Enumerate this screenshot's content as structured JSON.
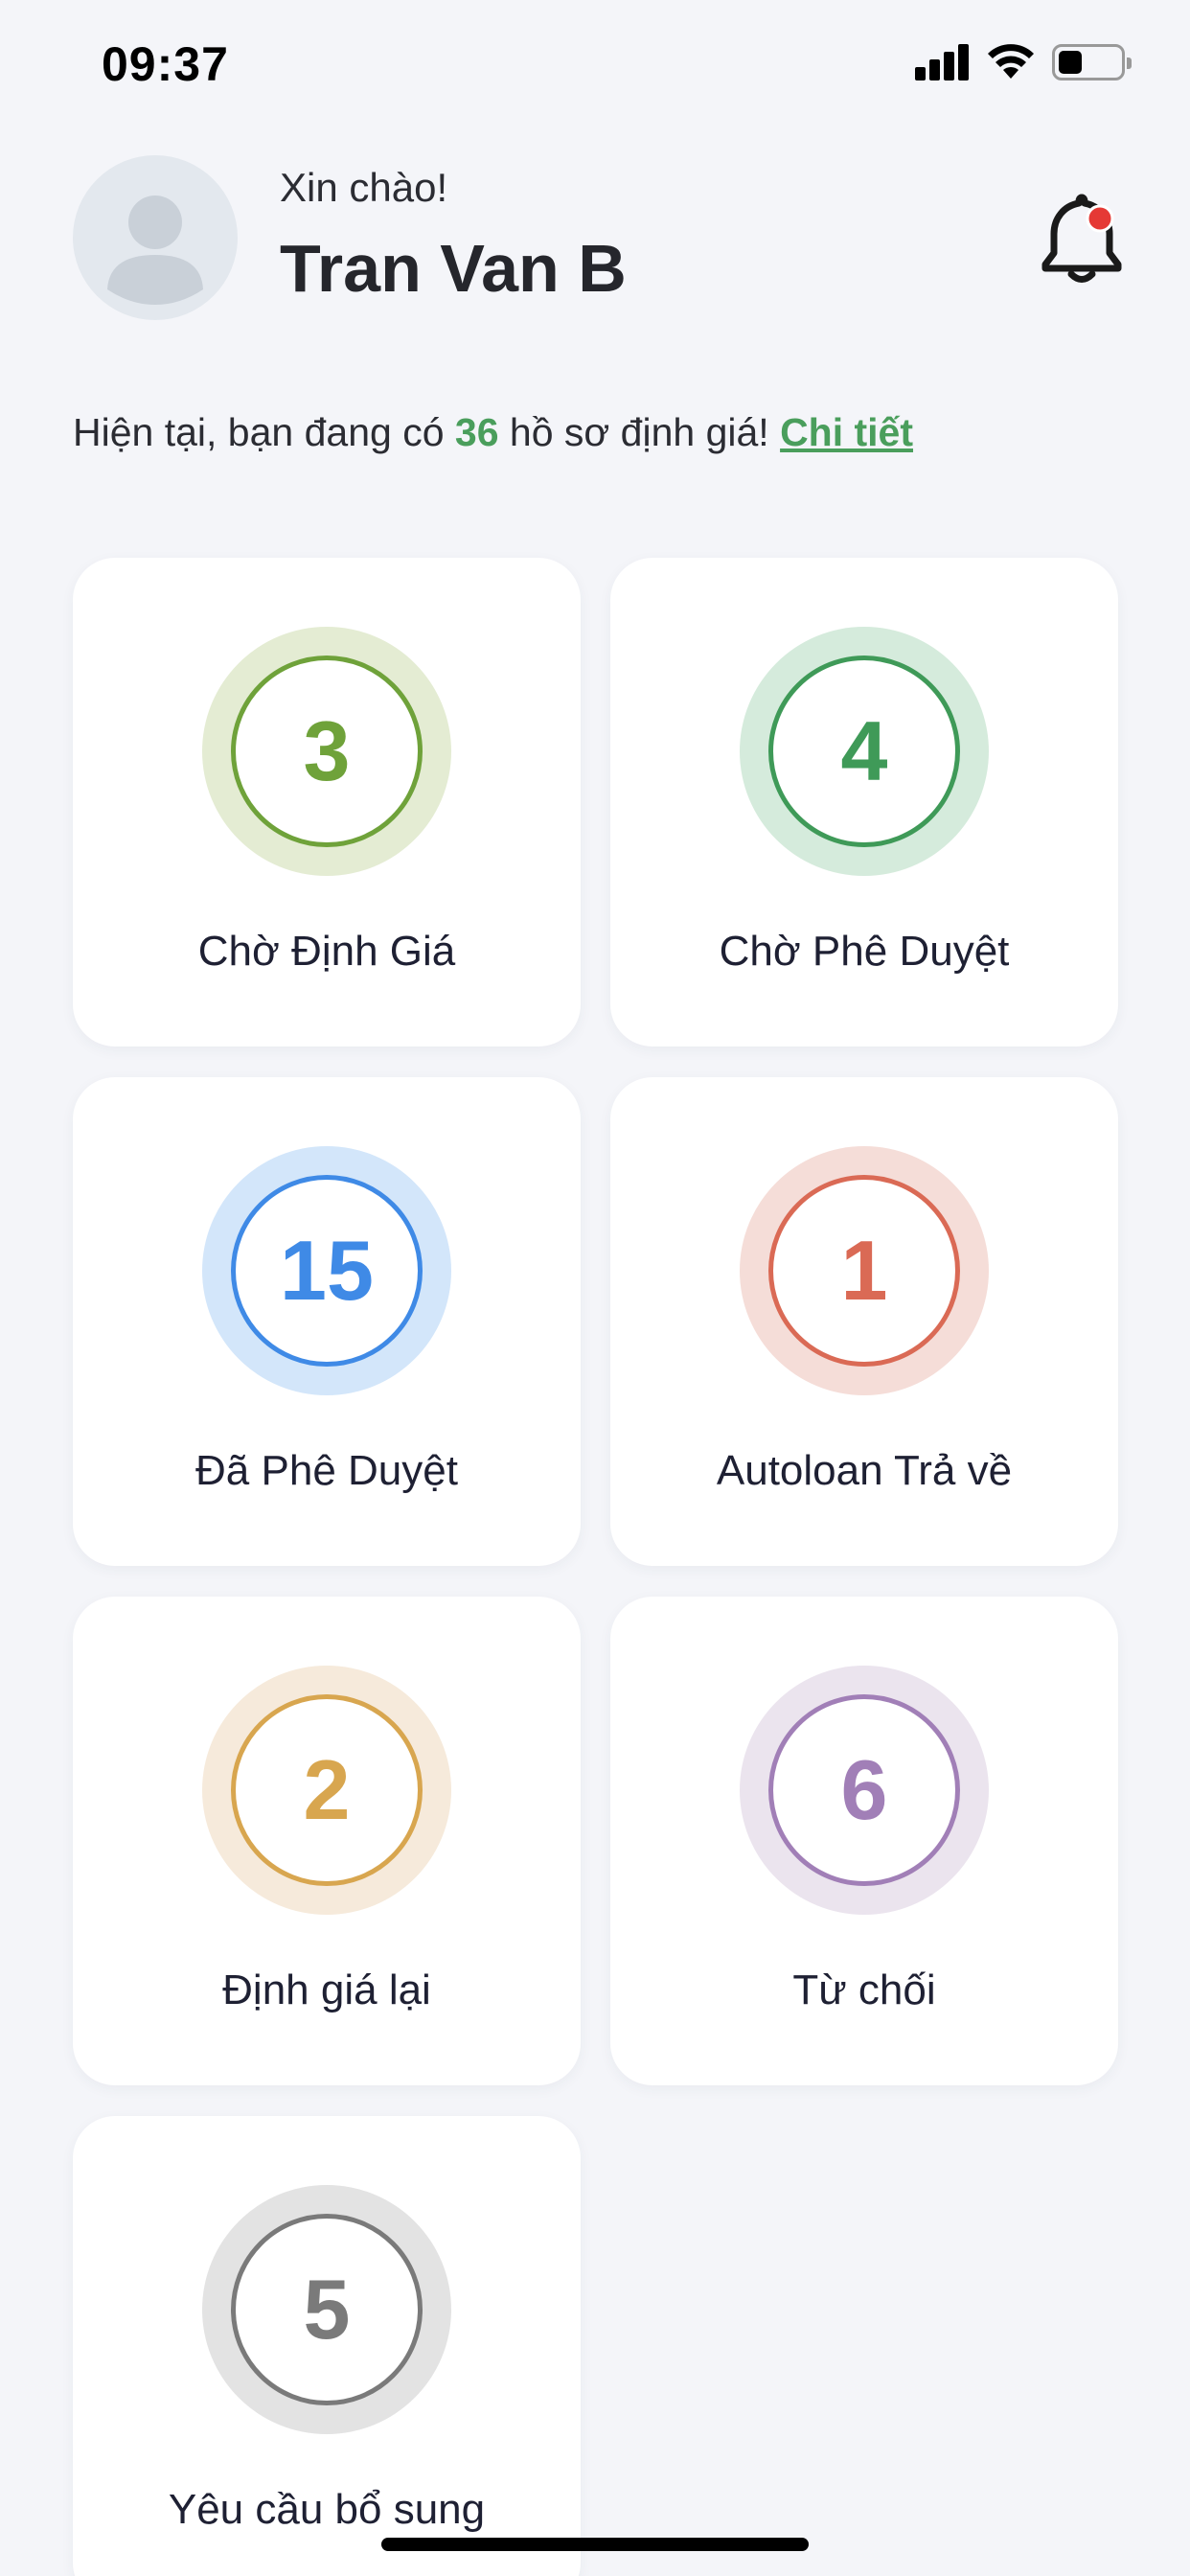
{
  "status_bar": {
    "time": "09:37",
    "icons": [
      "cellular-signal-icon",
      "wifi-icon",
      "battery-icon"
    ]
  },
  "header": {
    "greeting": "Xin chào!",
    "user_name": "Tran Van B",
    "avatar_icon": "user-avatar-icon",
    "notification_icon": "bell-icon",
    "has_notification": true
  },
  "summary": {
    "prefix": "Hiện tại, bạn đang có ",
    "count": "36",
    "suffix": " hồ sơ định giá! ",
    "detail_link": "Chi tiết"
  },
  "cards": [
    {
      "label": "Chờ Định Giá",
      "value": "3",
      "color": "#6fa23a",
      "halo": "#e4ecd3"
    },
    {
      "label": "Chờ Phê Duyệt",
      "value": "4",
      "color": "#3f9a58",
      "halo": "#d5ebdc"
    },
    {
      "label": "Đã Phê Duyệt",
      "value": "15",
      "color": "#3f8ae6",
      "halo": "#d3e6fa"
    },
    {
      "label": "Autoloan Trả về",
      "value": "1",
      "color": "#da6a55",
      "halo": "#f5ddd8"
    },
    {
      "label": "Định giá lại",
      "value": "2",
      "color": "#d8a64f",
      "halo": "#f6eadb"
    },
    {
      "label": "Từ chối",
      "value": "6",
      "color": "#a17fb7",
      "halo": "#ebe4ee"
    },
    {
      "label": "Yêu cầu bổ sung",
      "value": "5",
      "color": "#7a7a7a",
      "halo": "#e3e3e3"
    }
  ],
  "colors": {
    "accent_green": "#4a9e5c",
    "background": "#f4f5f9",
    "card": "#ffffff",
    "badge_red": "#e53935"
  }
}
